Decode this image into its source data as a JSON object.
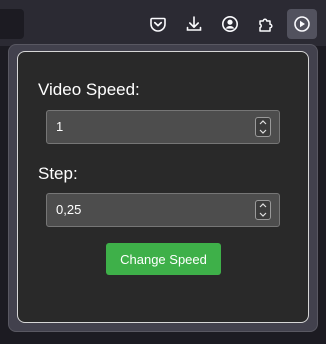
{
  "toolbar": {
    "icons": [
      "pocket-icon",
      "download-icon",
      "account-icon",
      "extensions-icon",
      "video-speed-extension-icon"
    ]
  },
  "popup": {
    "speed_label": "Video Speed:",
    "speed_value": "1",
    "step_label": "Step:",
    "step_value": "0,25",
    "change_button": "Change Speed"
  },
  "colors": {
    "button_green": "#3eb049",
    "panel_bg": "#292929",
    "input_bg": "#4d4d4d"
  }
}
